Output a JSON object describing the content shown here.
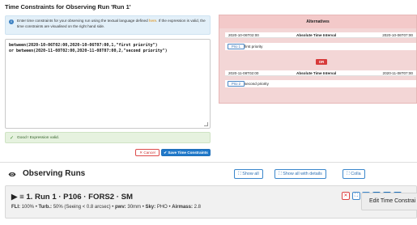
{
  "dialog": {
    "title": "Time Constraints for Observing Run 'Run 1'",
    "info_pre": "Enter time constraints for your observing run using the textual language defined ",
    "info_link": "here",
    "info_post": ". If the expression is valid, the time constraints are visualised on the right hand side.",
    "expression_lines": [
      "between(2020-10-06T02:00,2020-10-06T07:00,1,\"first priority\")",
      "or between(2020-11-08T02:00,2020-11-08T07:00,2,\"second priority\")"
    ],
    "success_message": "Good ! Expression valid.",
    "cancel_label": "Cancel",
    "save_label": "Save Time Constraints"
  },
  "alternatives": {
    "header": "Alternatives",
    "items": [
      {
        "start": "2020-10-06T02:00",
        "type": "Absolute Time Interval",
        "end": "2020-10-06T07:00",
        "prio_label": "Prio 1",
        "prio_text": "first priority"
      },
      {
        "start": "2020-11-08T02:00",
        "type": "Absolute Time Interval",
        "end": "2020-11-08T07:00",
        "prio_label": "Prio 2",
        "prio_text": "second priority"
      }
    ],
    "or_label": "OR"
  },
  "runs": {
    "title": "Observing Runs",
    "show_all": "Show all",
    "show_all_details": "Show all with details",
    "collapse": "Colla",
    "tooltip": "Edit Time Constrai",
    "run": {
      "heading": "1. Run 1 · P106 · FORS2 · SM",
      "fli_label": "FLI:",
      "fli_value": "100%",
      "turb_label": "Turb.:",
      "turb_value": "50% (Seeing < 0.8 arcsec)",
      "pwv_label": "pwv:",
      "pwv_value": "30mm",
      "sky_label": "Sky:",
      "sky_value": "PHO",
      "airmass_label": "Airmass:",
      "airmass_value": "2.8"
    }
  },
  "icons": {
    "info": "i",
    "check": "✓",
    "cancel": "✕",
    "save": "✔",
    "expand": "⛶",
    "caret": "▶",
    "menu": "≡",
    "delete": "✕",
    "copy": "❐",
    "star": "✱",
    "edit": "✎"
  }
}
